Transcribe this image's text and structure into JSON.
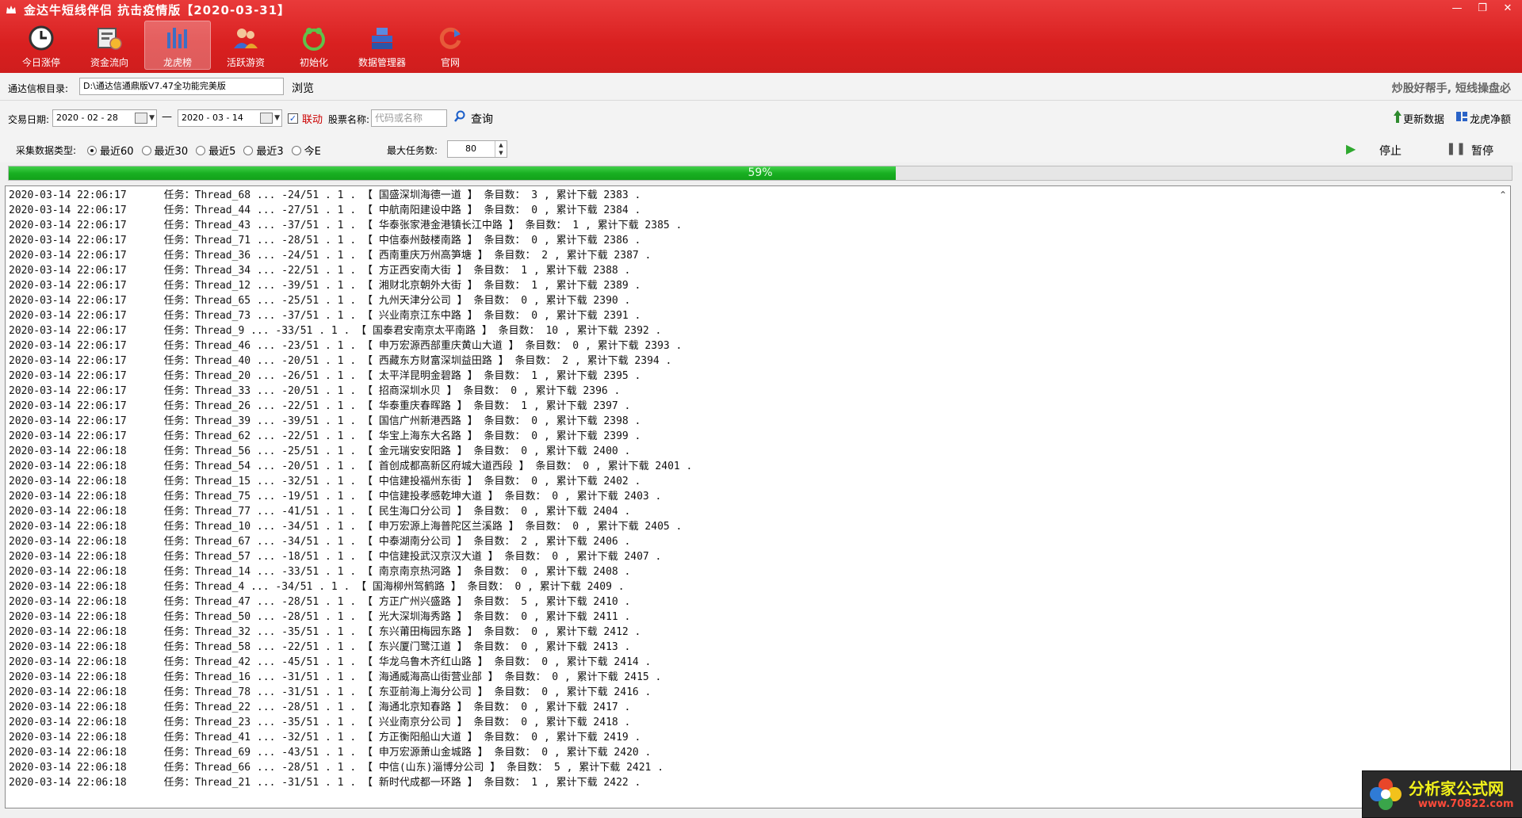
{
  "window": {
    "title": "金达牛短线伴侣  抗击疫情版【2020-03-31】",
    "controls": [
      "minimize",
      "restore",
      "close"
    ]
  },
  "toolbar": {
    "items": [
      {
        "label": "今日涨停",
        "icon": "clock-icon"
      },
      {
        "label": "资金流向",
        "icon": "money-flow-icon"
      },
      {
        "label": "龙虎榜",
        "icon": "bar-chart-icon",
        "active": true
      },
      {
        "label": "活跃游资",
        "icon": "people-icon"
      },
      {
        "label": "初始化",
        "icon": "init-icon"
      },
      {
        "label": "数据管理器",
        "icon": "server-icon"
      },
      {
        "label": "官网",
        "icon": "refresh-icon"
      }
    ]
  },
  "dir": {
    "label": "通达信根目录:",
    "value": "D:\\通达信通鼎版V7.47全功能完美版",
    "browse": "浏览",
    "slogan": "炒股好帮手, 短线操盘必"
  },
  "filter": {
    "date_label": "交易日期:",
    "date_from": "2020 - 02 - 28",
    "date_sep": "—",
    "date_to": "2020 - 03 - 14",
    "link_label": "联动",
    "stock_label": "股票名称:",
    "stock_placeholder": "代码或名称",
    "query": "查询",
    "update_data": "更新数据",
    "lhb_net": "龙虎净额"
  },
  "collect": {
    "type_label": "采集数据类型:",
    "options": [
      "最近60",
      "最近30",
      "最近5",
      "最近3",
      "今E"
    ],
    "selected": 0,
    "max_tasks_label": "最大任务数:",
    "max_tasks": "80",
    "stop": "停止",
    "pause": "暂停"
  },
  "progress": {
    "percent": 59,
    "text": "59%"
  },
  "log": [
    "2020-03-14 22:06:17      任务：Thread_68 ... -24/51 . 1 . 【 国盛深圳海德一道 】 条目数： 3 , 累计下载 2383 .",
    "2020-03-14 22:06:17      任务：Thread_44 ... -27/51 . 1 . 【 中航南阳建设中路 】 条目数： 0 , 累计下载 2384 .",
    "2020-03-14 22:06:17      任务：Thread_43 ... -37/51 . 1 . 【 华泰张家港金港镇长江中路 】 条目数： 1 , 累计下载 2385 .",
    "2020-03-14 22:06:17      任务：Thread_71 ... -28/51 . 1 . 【 中信泰州鼓楼南路 】 条目数： 0 , 累计下载 2386 .",
    "2020-03-14 22:06:17      任务：Thread_36 ... -24/51 . 1 . 【 西南重庆万州高笋塘 】 条目数： 2 , 累计下载 2387 .",
    "2020-03-14 22:06:17      任务：Thread_34 ... -22/51 . 1 . 【 方正西安南大街 】 条目数： 1 , 累计下载 2388 .",
    "2020-03-14 22:06:17      任务：Thread_12 ... -39/51 . 1 . 【 湘财北京朝外大街 】 条目数： 1 , 累计下载 2389 .",
    "2020-03-14 22:06:17      任务：Thread_65 ... -25/51 . 1 . 【 九州天津分公司 】 条目数： 0 , 累计下载 2390 .",
    "2020-03-14 22:06:17      任务：Thread_73 ... -37/51 . 1 . 【 兴业南京江东中路 】 条目数： 0 , 累计下载 2391 .",
    "2020-03-14 22:06:17      任务：Thread_9 ... -33/51 . 1 . 【 国泰君安南京太平南路 】 条目数： 10 , 累计下载 2392 .",
    "2020-03-14 22:06:17      任务：Thread_46 ... -23/51 . 1 . 【 申万宏源西部重庆黄山大道 】 条目数： 0 , 累计下载 2393 .",
    "2020-03-14 22:06:17      任务：Thread_40 ... -20/51 . 1 . 【 西藏东方财富深圳益田路 】 条目数： 2 , 累计下载 2394 .",
    "2020-03-14 22:06:17      任务：Thread_20 ... -26/51 . 1 . 【 太平洋昆明金碧路 】 条目数： 1 , 累计下载 2395 .",
    "2020-03-14 22:06:17      任务：Thread_33 ... -20/51 . 1 . 【 招商深圳水贝 】 条目数： 0 , 累计下载 2396 .",
    "2020-03-14 22:06:17      任务：Thread_26 ... -22/51 . 1 . 【 华泰重庆春晖路 】 条目数： 1 , 累计下载 2397 .",
    "2020-03-14 22:06:17      任务：Thread_39 ... -39/51 . 1 . 【 国信广州新港西路 】 条目数： 0 , 累计下载 2398 .",
    "2020-03-14 22:06:17      任务：Thread_62 ... -22/51 . 1 . 【 华宝上海东大名路 】 条目数： 0 , 累计下载 2399 .",
    "2020-03-14 22:06:18      任务：Thread_56 ... -25/51 . 1 . 【 金元瑞安安阳路 】 条目数： 0 , 累计下载 2400 .",
    "2020-03-14 22:06:18      任务：Thread_54 ... -20/51 . 1 . 【 首创成都高新区府城大道西段 】 条目数： 0 , 累计下载 2401 .",
    "2020-03-14 22:06:18      任务：Thread_15 ... -32/51 . 1 . 【 中信建投福州东街 】 条目数： 0 , 累计下载 2402 .",
    "2020-03-14 22:06:18      任务：Thread_75 ... -19/51 . 1 . 【 中信建投孝感乾坤大道 】 条目数： 0 , 累计下载 2403 .",
    "2020-03-14 22:06:18      任务：Thread_77 ... -41/51 . 1 . 【 民生海口分公司 】 条目数： 0 , 累计下载 2404 .",
    "2020-03-14 22:06:18      任务：Thread_10 ... -34/51 . 1 . 【 申万宏源上海普陀区兰溪路 】 条目数： 0 , 累计下载 2405 .",
    "2020-03-14 22:06:18      任务：Thread_67 ... -34/51 . 1 . 【 中泰湖南分公司 】 条目数： 2 , 累计下载 2406 .",
    "2020-03-14 22:06:18      任务：Thread_57 ... -18/51 . 1 . 【 中信建投武汉京汉大道 】 条目数： 0 , 累计下载 2407 .",
    "2020-03-14 22:06:18      任务：Thread_14 ... -33/51 . 1 . 【 南京南京热河路 】 条目数： 0 , 累计下载 2408 .",
    "2020-03-14 22:06:18      任务：Thread_4 ... -34/51 . 1 . 【 国海柳州驾鹤路 】 条目数： 0 , 累计下载 2409 .",
    "2020-03-14 22:06:18      任务：Thread_47 ... -28/51 . 1 . 【 方正广州兴盛路 】 条目数： 5 , 累计下载 2410 .",
    "2020-03-14 22:06:18      任务：Thread_50 ... -28/51 . 1 . 【 光大深圳海秀路 】 条目数： 0 , 累计下载 2411 .",
    "2020-03-14 22:06:18      任务：Thread_32 ... -35/51 . 1 . 【 东兴莆田梅园东路 】 条目数： 0 , 累计下载 2412 .",
    "2020-03-14 22:06:18      任务：Thread_58 ... -22/51 . 1 . 【 东兴厦门鹭江道 】 条目数： 0 , 累计下载 2413 .",
    "2020-03-14 22:06:18      任务：Thread_42 ... -45/51 . 1 . 【 华龙乌鲁木齐红山路 】 条目数： 0 , 累计下载 2414 .",
    "2020-03-14 22:06:18      任务：Thread_16 ... -31/51 . 1 . 【 海通威海高山街营业部 】 条目数： 0 , 累计下载 2415 .",
    "2020-03-14 22:06:18      任务：Thread_78 ... -31/51 . 1 . 【 东亚前海上海分公司 】 条目数： 0 , 累计下载 2416 .",
    "2020-03-14 22:06:18      任务：Thread_22 ... -28/51 . 1 . 【 海通北京知春路 】 条目数： 0 , 累计下载 2417 .",
    "2020-03-14 22:06:18      任务：Thread_23 ... -35/51 . 1 . 【 兴业南京分公司 】 条目数： 0 , 累计下载 2418 .",
    "2020-03-14 22:06:18      任务：Thread_41 ... -32/51 . 1 . 【 方正衡阳船山大道 】 条目数： 0 , 累计下载 2419 .",
    "2020-03-14 22:06:18      任务：Thread_69 ... -43/51 . 1 . 【 申万宏源萧山金城路 】 条目数： 0 , 累计下载 2420 .",
    "2020-03-14 22:06:18      任务：Thread_66 ... -28/51 . 1 . 【 中信(山东)淄博分公司 】 条目数： 5 , 累计下载 2421 .",
    "2020-03-14 22:06:18      任务：Thread_21 ... -31/51 . 1 . 【 新时代成都一环路 】 条目数： 1 , 累计下载 2422 ."
  ],
  "watermark": {
    "line1": "分析家公式网",
    "line2": "www.70822.com"
  },
  "colors": {
    "header": "#d92020",
    "progress": "#19b022"
  }
}
